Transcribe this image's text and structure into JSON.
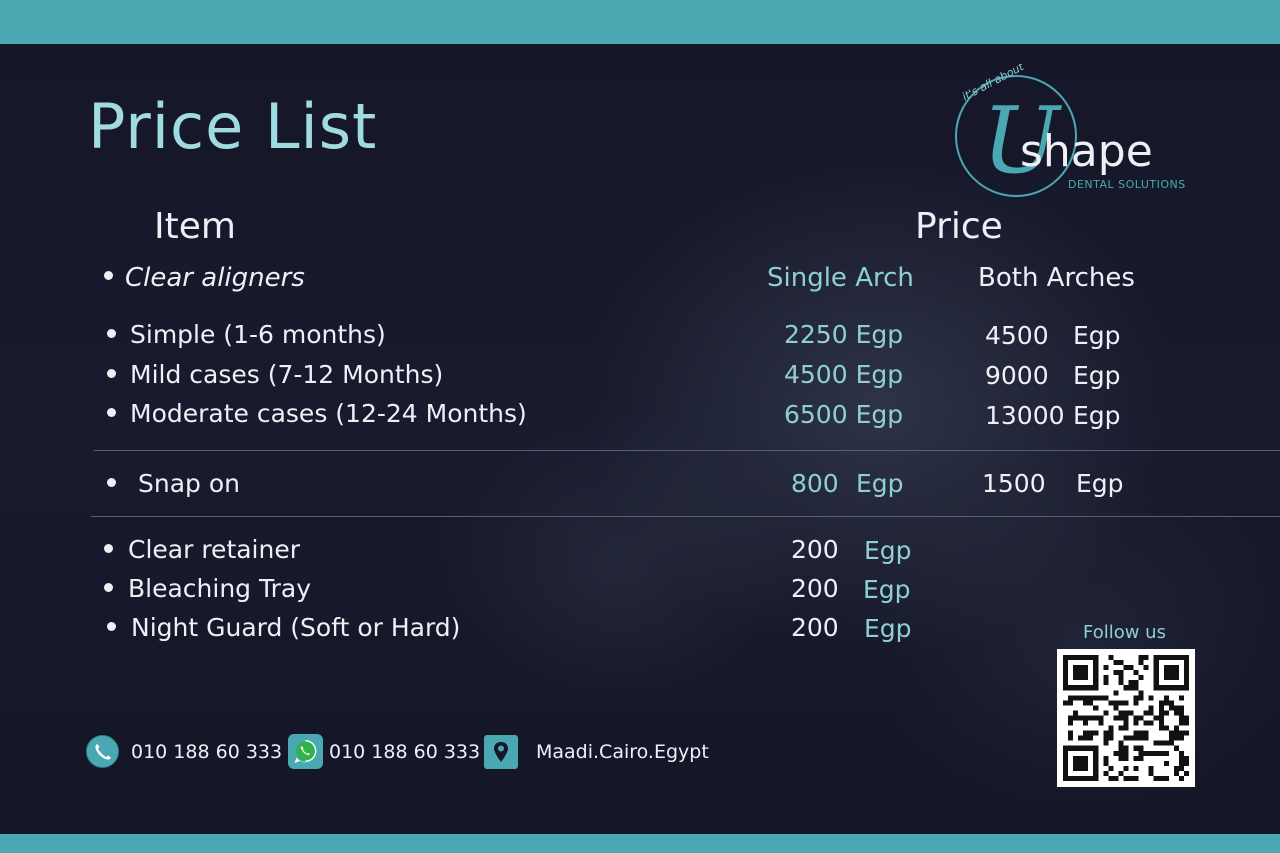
{
  "header": {
    "title": "Price List"
  },
  "brand": {
    "tagline": "it's all about",
    "initial": "U",
    "name": "shape",
    "subtitle": "DENTAL SOLUTIONS"
  },
  "table": {
    "item_header": "Item",
    "price_header": "Price",
    "section_label": "Clear aligners",
    "col_single": "Single Arch",
    "col_both": "Both Arches",
    "aligners": [
      {
        "label": "Simple (1-6 months)",
        "single": "2250 Egp",
        "both_num": "4500",
        "both_unit": "Egp"
      },
      {
        "label": "Mild cases (7-12 Months)",
        "single": "4500 Egp",
        "both_num": "9000",
        "both_unit": "Egp"
      },
      {
        "label": "Moderate cases (12-24 Months)",
        "single": "6500 Egp",
        "both_num": "13000",
        "both_unit": "Egp"
      }
    ],
    "snap_on": {
      "label": "Snap on",
      "single_num": "800",
      "single_unit": "Egp",
      "both_num": "1500",
      "both_unit": "Egp"
    },
    "others": [
      {
        "label": "Clear retainer",
        "num": "200",
        "unit": "Egp"
      },
      {
        "label": "Bleaching Tray",
        "num": "200",
        "unit": "Egp"
      },
      {
        "label": "Night Guard (Soft or Hard)",
        "num": "200",
        "unit": "Egp"
      }
    ]
  },
  "footer": {
    "phone": "010 188 60 333",
    "whatsapp": "010 188 60 333",
    "location": "Maadi.Cairo.Egypt",
    "follow_label": "Follow us"
  },
  "icons": [
    "phone-icon",
    "whatsapp-icon",
    "location-pin-icon",
    "qr-code"
  ],
  "colors": {
    "band": "#4aa8b2",
    "accent": "#8ecfd6",
    "background": "#15172a"
  }
}
